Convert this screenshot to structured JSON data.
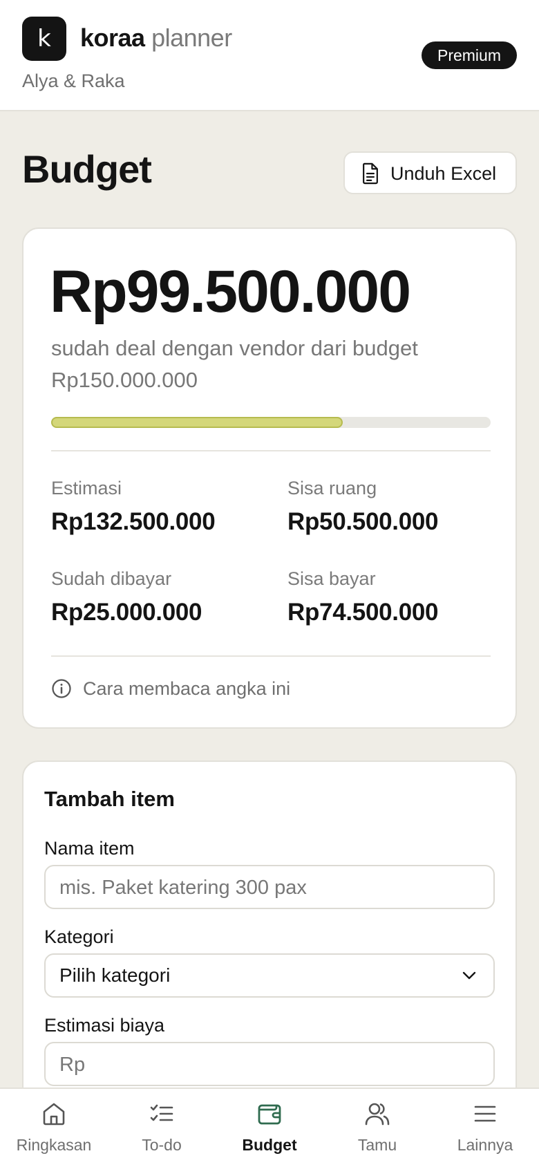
{
  "header": {
    "logo_letter": "k",
    "brand_bold": "koraa",
    "brand_light": "planner",
    "couple": "Alya & Raka",
    "badge": "Premium"
  },
  "page": {
    "title": "Budget",
    "download_label": "Unduh Excel"
  },
  "summary": {
    "deal_amount": "Rp99.500.000",
    "deal_text": "sudah deal dengan vendor dari budget Rp150.000.000",
    "progress_fraction": 0.663,
    "stats": [
      {
        "label": "Estimasi",
        "value": "Rp132.500.000"
      },
      {
        "label": "Sisa ruang",
        "value": "Rp50.500.000"
      },
      {
        "label": "Sudah dibayar",
        "value": "Rp25.000.000"
      },
      {
        "label": "Sisa bayar",
        "value": "Rp74.500.000"
      }
    ],
    "info_link": "Cara membaca angka ini"
  },
  "add_item": {
    "title": "Tambah item",
    "name_label": "Nama item",
    "name_placeholder": "mis. Paket katering 300 pax",
    "category_label": "Kategori",
    "category_value": "Pilih kategori",
    "cost_label": "Estimasi biaya",
    "cost_placeholder": "Rp"
  },
  "nav": {
    "items": [
      {
        "label": "Ringkasan",
        "icon": "home-icon"
      },
      {
        "label": "To-do",
        "icon": "checklist-icon"
      },
      {
        "label": "Budget",
        "icon": "wallet-icon",
        "active": true
      },
      {
        "label": "Tamu",
        "icon": "users-icon"
      },
      {
        "label": "Lainnya",
        "icon": "menu-icon"
      }
    ]
  },
  "colors": {
    "progress_fill": "#d4d77a",
    "progress_track": "#e8e7e2",
    "active_nav_icon": "#2f6b4f",
    "background": "#efede6"
  }
}
